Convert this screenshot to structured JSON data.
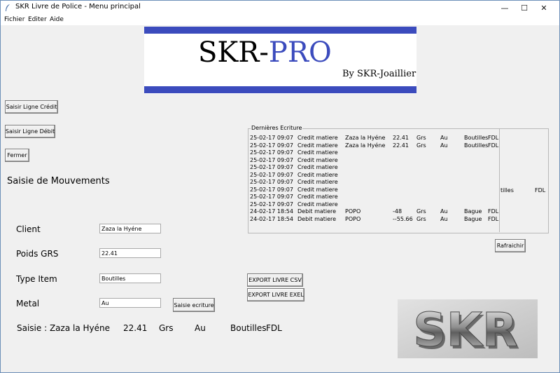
{
  "window": {
    "title": "SKR Livre de Police  -  Menu principal",
    "minimize": "—",
    "maximize": "☐",
    "close": "✕"
  },
  "menu": [
    "Fichier",
    "Editer",
    "Aide"
  ],
  "banner": {
    "skr": "SKR-",
    "pro": "PRO",
    "by": "By SKR-Joaillier",
    "accent_color": "#3b4bbd"
  },
  "buttons": {
    "credit": "Saisir Ligne Crédit",
    "debit": "Saisir Ligne Débit",
    "close": "Fermer",
    "save": "Saisie ecriture",
    "refresh": "Rafraichir",
    "export_csv": "EXPORT LIVRE CSV",
    "export_excel": "EXPORT LIVRE EXEL"
  },
  "section_title": "Saisie de Mouvements",
  "form": {
    "client_label": "Client",
    "client_value": "Zaza la Hyéne",
    "weight_label": "Poids GRS",
    "weight_value": "22.41",
    "type_label": "Type Item",
    "type_value": "Boutilles",
    "metal_label": "Metal",
    "metal_value": "Au"
  },
  "ledger": {
    "title": "Dernières Ecriture",
    "rows": [
      {
        "date": "25-02-17 09:07",
        "op": "Credit matiere",
        "client": "Zaza la Hyéne",
        "weight": "22.41",
        "unit": "Grs",
        "metal": "Au",
        "item": "Boutilles",
        "code": "FDL"
      },
      {
        "date": "25-02-17 09:07",
        "op": "Credit matiere",
        "client": "Zaza la Hyéne",
        "weight": "22.41",
        "unit": "Grs",
        "metal": "Au",
        "item": "Boutilles",
        "code": "FDL"
      },
      {
        "date": "25-02-17 09:07",
        "op": "Credit matiere",
        "client": "",
        "weight": "",
        "unit": "",
        "metal": "",
        "item": "",
        "code": ""
      },
      {
        "date": "25-02-17 09:07",
        "op": "Credit matiere",
        "client": "",
        "weight": "",
        "unit": "",
        "metal": "",
        "item": "",
        "code": ""
      },
      {
        "date": "25-02-17 09:07",
        "op": "Credit matiere",
        "client": "",
        "weight": "",
        "unit": "",
        "metal": "",
        "item": "",
        "code": ""
      },
      {
        "date": "25-02-17 09:07",
        "op": "Credit matiere",
        "client": "",
        "weight": "",
        "unit": "",
        "metal": "",
        "item": "",
        "code": ""
      },
      {
        "date": "25-02-17 09:07",
        "op": "Credit matiere",
        "client": "",
        "weight": "",
        "unit": "",
        "metal": "",
        "item": "",
        "code": ""
      },
      {
        "date": "25-02-17 09:07",
        "op": "Credit matiere",
        "client": "",
        "weight": "",
        "unit": "",
        "metal": "",
        "item": "",
        "code": ""
      },
      {
        "date": "25-02-17 09:07",
        "op": "Credit matiere",
        "client": "",
        "weight": "",
        "unit": "",
        "metal": "",
        "item": "",
        "code": ""
      },
      {
        "date": "25-02-17 09:07",
        "op": "Credit matiere",
        "client": "",
        "weight": "",
        "unit": "",
        "metal": "",
        "item": "",
        "code": ""
      },
      {
        "date": "24-02-17 18:54",
        "op": "Debit matiere",
        "client": "POPO",
        "weight": "-48",
        "unit": "Grs",
        "metal": "Au",
        "item": "Bague",
        "code": "FDL"
      },
      {
        "date": "24-02-17 18:54",
        "op": "Debit matiere",
        "client": "POPO",
        "weight": "--55.66",
        "unit": "Grs",
        "metal": "Au",
        "item": "Bague",
        "code": "FDL"
      }
    ],
    "side_item": "tilles",
    "side_code": "FDL"
  },
  "summary": {
    "prefix": "Saisie : Zaza la Hyéne",
    "weight": "22.41",
    "unit": "Grs",
    "metal": "Au",
    "item": "Boutilles",
    "code": "FDL"
  },
  "logo_image": {
    "text": "SKR"
  }
}
